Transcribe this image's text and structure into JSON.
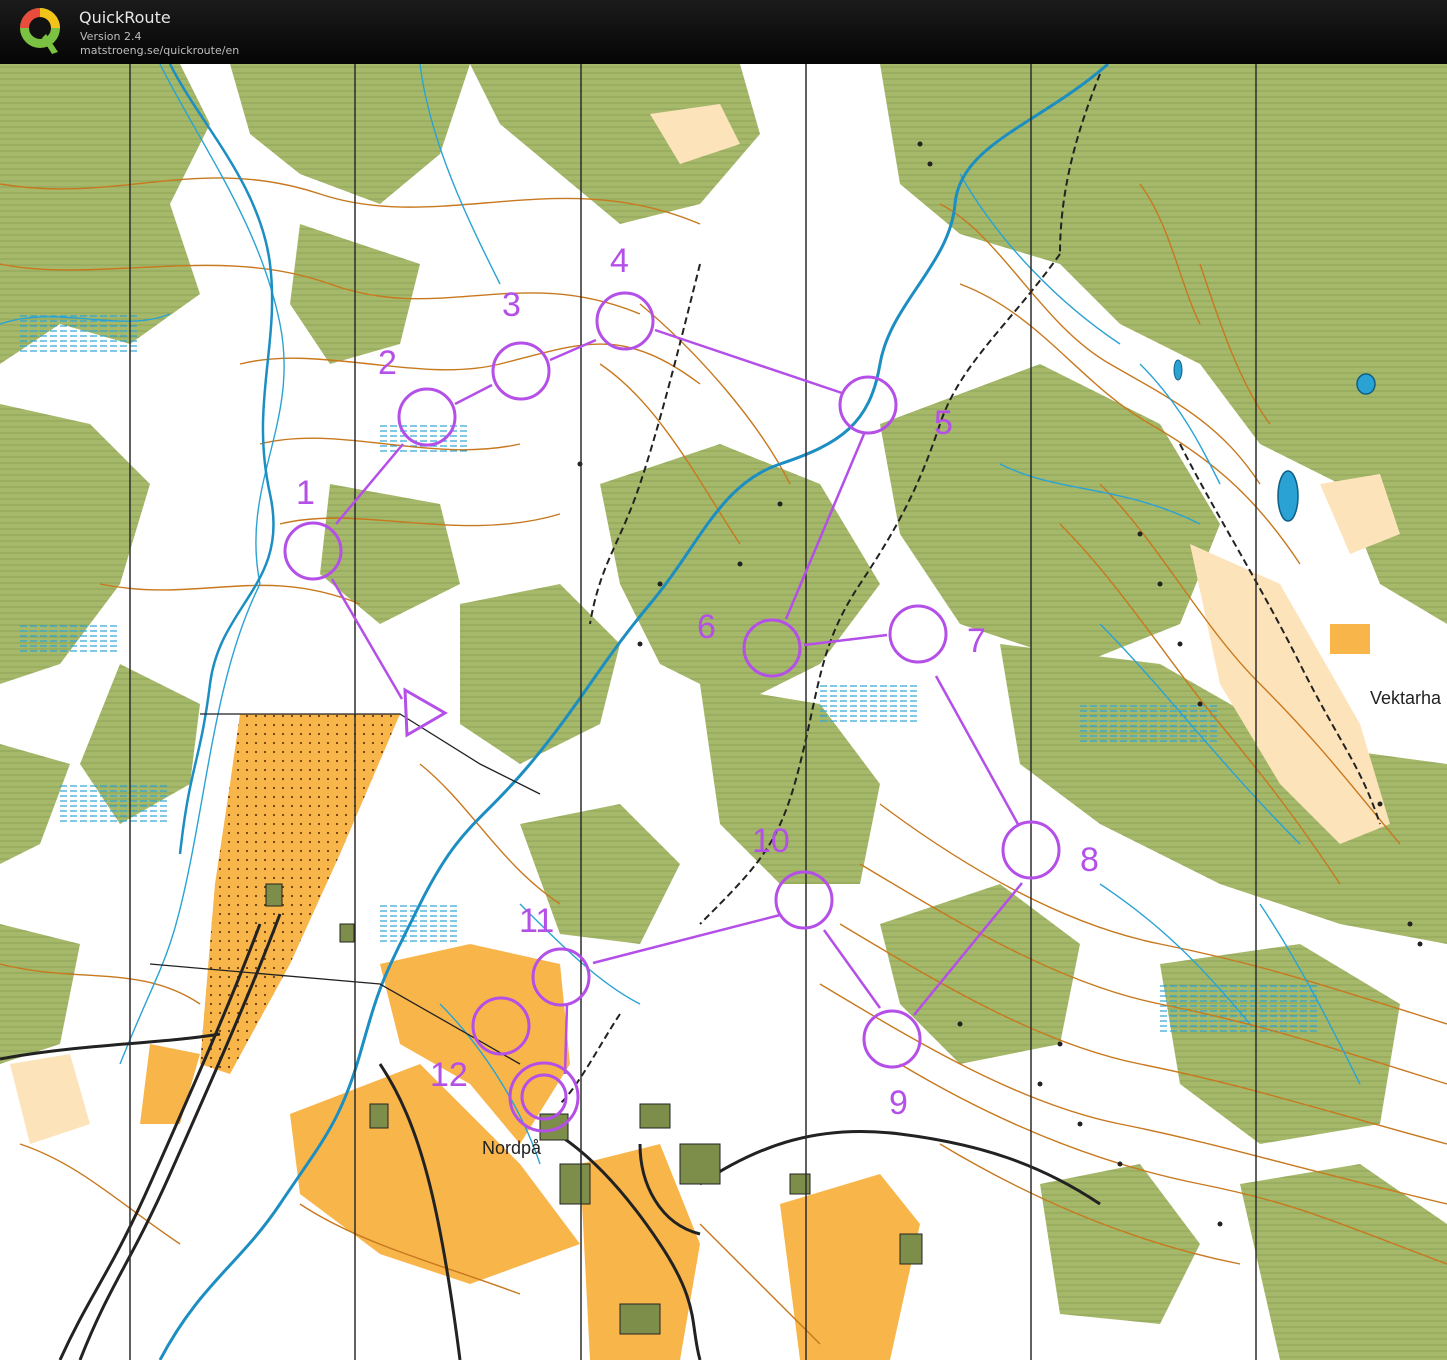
{
  "app": {
    "title": "QuickRoute",
    "version": "Version 2.4",
    "url": "matstroeng.se/quickroute/en",
    "logo_letter": "Q"
  },
  "map": {
    "place_names": [
      "Vektarha",
      "Nordpå"
    ],
    "colors": {
      "forest_green": "#a6b86a",
      "open_field": "#f8b54a",
      "light_open": "#fde3ba",
      "contour_brown": "#c8781e",
      "water_blue": "#2aa3d4",
      "course_purple": "#b44fe8",
      "magnetic_north": "#2d2d2d"
    },
    "course": {
      "start_label": "",
      "controls": [
        {
          "id": "1",
          "label": "1"
        },
        {
          "id": "2",
          "label": "2"
        },
        {
          "id": "3",
          "label": "3"
        },
        {
          "id": "4",
          "label": "4"
        },
        {
          "id": "5",
          "label": "5"
        },
        {
          "id": "6",
          "label": "6"
        },
        {
          "id": "7",
          "label": "7"
        },
        {
          "id": "8",
          "label": "8"
        },
        {
          "id": "9",
          "label": "9"
        },
        {
          "id": "10",
          "label": "10"
        },
        {
          "id": "11",
          "label": "11"
        },
        {
          "id": "12",
          "label": "12"
        }
      ],
      "finish_label": ""
    }
  }
}
